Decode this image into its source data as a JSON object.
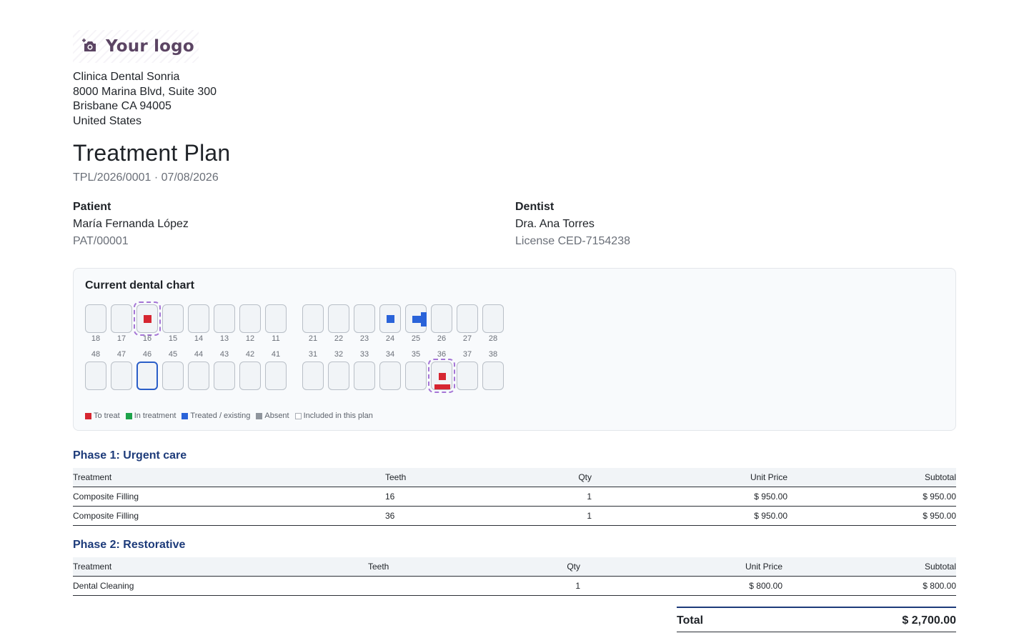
{
  "logo": {
    "text": "Your logo",
    "icon": "camera-plus-icon"
  },
  "company": {
    "name": "Clinica Dental Sonria",
    "address1": "8000 Marina Blvd, Suite 300",
    "address2": "Brisbane CA 94005",
    "country": "United States"
  },
  "document": {
    "title": "Treatment Plan",
    "reference": "TPL/2026/0001 · 07/08/2026"
  },
  "patient": {
    "label": "Patient",
    "name": "María Fernanda López",
    "id": "PAT/00001"
  },
  "dentist": {
    "label": "Dentist",
    "name": "Dra. Ana Torres",
    "license": "License CED-7154238"
  },
  "chart": {
    "title": "Current dental chart",
    "upper_teeth": [
      "18",
      "17",
      "16",
      "15",
      "14",
      "13",
      "12",
      "11",
      "21",
      "22",
      "23",
      "24",
      "25",
      "26",
      "27",
      "28"
    ],
    "lower_teeth": [
      "48",
      "47",
      "46",
      "45",
      "44",
      "43",
      "42",
      "41",
      "31",
      "32",
      "33",
      "34",
      "35",
      "36",
      "37",
      "38"
    ],
    "teeth_in_plan": [
      "16",
      "36"
    ],
    "selected_tooth": "46",
    "legend": [
      {
        "label": "To treat",
        "color": "#d62631"
      },
      {
        "label": "In treatment",
        "color": "#1ea34a"
      },
      {
        "label": "Treated / existing",
        "color": "#2a63d9"
      },
      {
        "label": "Absent",
        "color": "#8f959d"
      },
      {
        "label": "Included in this plan",
        "color": "#ffffff"
      }
    ]
  },
  "phases": [
    {
      "title": "Phase 1: Urgent care",
      "headers": {
        "treatment": "Treatment",
        "teeth": "Teeth",
        "qty": "Qty",
        "unit_price": "Unit Price",
        "subtotal": "Subtotal"
      },
      "rows": [
        {
          "treatment": "Composite Filling",
          "teeth": "16",
          "qty": "1",
          "unit_price": "$ 950.00",
          "subtotal": "$ 950.00"
        },
        {
          "treatment": "Composite Filling",
          "teeth": "36",
          "qty": "1",
          "unit_price": "$ 950.00",
          "subtotal": "$ 950.00"
        }
      ]
    },
    {
      "title": "Phase 2: Restorative",
      "headers": {
        "treatment": "Treatment",
        "teeth": "Teeth",
        "qty": "Qty",
        "unit_price": "Unit Price",
        "subtotal": "Subtotal"
      },
      "rows": [
        {
          "treatment": "Dental Cleaning",
          "teeth": "",
          "qty": "1",
          "unit_price": "$ 800.00",
          "subtotal": "$ 800.00"
        }
      ]
    }
  ],
  "total": {
    "label": "Total",
    "value": "$ 2,700.00"
  }
}
